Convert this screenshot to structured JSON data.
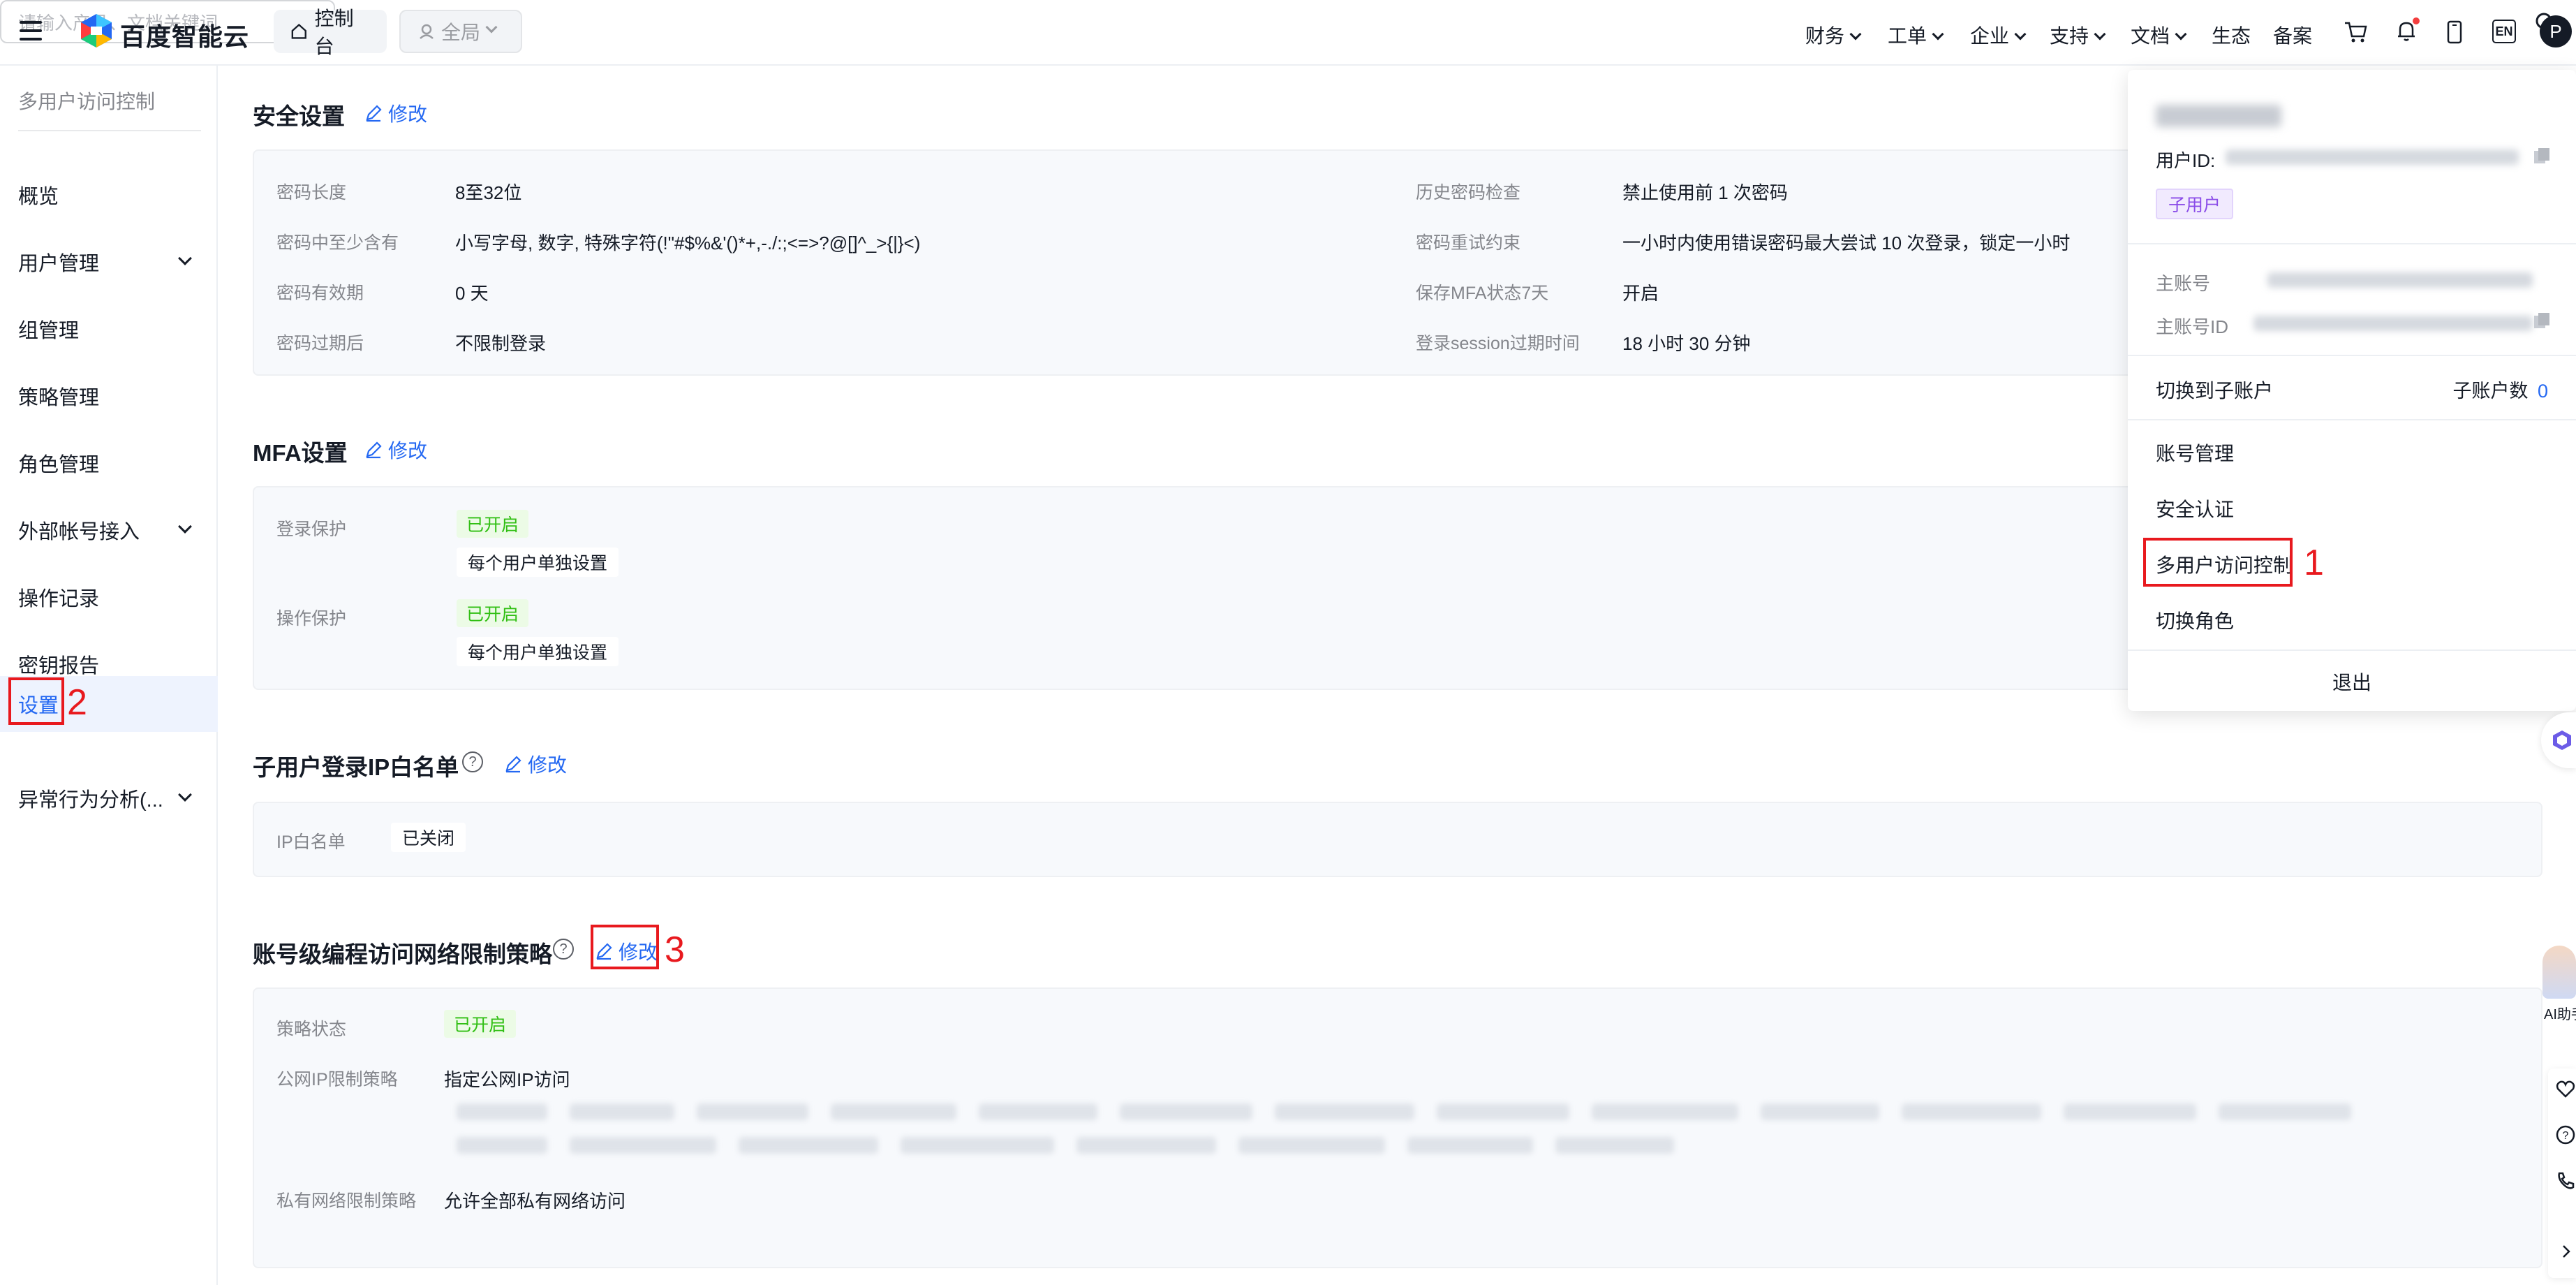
{
  "topbar": {
    "logo_text": "百度智能云",
    "console": "控制台",
    "region": "全局",
    "search_placeholder": "请输入产品、文档关键词",
    "nav": [
      {
        "label": "财务",
        "has_menu": true
      },
      {
        "label": "工单",
        "has_menu": true
      },
      {
        "label": "企业",
        "has_menu": true
      },
      {
        "label": "支持",
        "has_menu": true
      },
      {
        "label": "文档",
        "has_menu": true
      },
      {
        "label": "生态",
        "has_menu": false
      },
      {
        "label": "备案",
        "has_menu": false
      }
    ],
    "lang": "EN",
    "avatar": "P",
    "icons": [
      "cart-icon",
      "bell-icon",
      "phone-icon"
    ]
  },
  "sidebar": {
    "title": "多用户访问控制",
    "items": [
      {
        "label": "概览",
        "has_children": false
      },
      {
        "label": "用户管理",
        "has_children": true
      },
      {
        "label": "组管理",
        "has_children": false
      },
      {
        "label": "策略管理",
        "has_children": false
      },
      {
        "label": "角色管理",
        "has_children": false
      },
      {
        "label": "外部帐号接入",
        "has_children": true
      },
      {
        "label": "操作记录",
        "has_children": false
      },
      {
        "label": "密钥报告",
        "has_children": false
      },
      {
        "label": "设置",
        "has_children": false,
        "active": true
      },
      {
        "label": "异常行为分析(...",
        "has_children": true
      }
    ]
  },
  "sections": {
    "security": {
      "title": "安全设置",
      "edit": "修改",
      "rows": [
        {
          "label": "密码长度",
          "value": "8至32位"
        },
        {
          "label": "密码中至少含有",
          "value": "小写字母, 数字, 特殊字符(!\"#$%&'()*+,-./:;<=>?@[]^_>{|}<)"
        },
        {
          "label": "密码有效期",
          "value": "0 天"
        },
        {
          "label": "密码过期后",
          "value": "不限制登录"
        }
      ],
      "rows_right": [
        {
          "label": "历史密码检查",
          "value": "禁止使用前 1 次密码"
        },
        {
          "label": "密码重试约束",
          "value": "一小时内使用错误密码最大尝试 10 次登录，锁定一小时"
        },
        {
          "label": "保存MFA状态7天",
          "value": "开启"
        },
        {
          "label": "登录session过期时间",
          "value": "18 小时 30 分钟"
        }
      ]
    },
    "mfa": {
      "title": "MFA设置",
      "edit": "修改",
      "rows": [
        {
          "label": "登录保护",
          "status": "已开启",
          "detail": "每个用户单独设置"
        },
        {
          "label": "操作保护",
          "status": "已开启",
          "detail": "每个用户单独设置"
        }
      ]
    },
    "ip_whitelist": {
      "title": "子用户登录IP白名单",
      "edit": "修改",
      "label": "IP白名单",
      "status": "已关闭"
    },
    "network_policy": {
      "title": "账号级编程访问网络限制策略",
      "edit": "修改",
      "status_label": "策略状态",
      "status": "已开启",
      "public_label": "公网IP限制策略",
      "public_value": "指定公网IP访问",
      "private_label": "私有网络限制策略",
      "private_value": "允许全部私有网络访问"
    }
  },
  "dropdown": {
    "user_id_label": "用户ID:",
    "role_tag": "子用户",
    "main_account_label": "主账号",
    "main_account_id_label": "主账号ID",
    "switch_sub": "切换到子账户",
    "sub_count_label": "子账户数",
    "sub_count": "0",
    "items": [
      "账号管理",
      "安全认证",
      "多用户访问控制",
      "切换角色"
    ],
    "logout": "退出"
  },
  "annotations": [
    "1",
    "2",
    "3"
  ],
  "side_float": {
    "ai_label": "AI助手"
  },
  "colors": {
    "accent": "#2468f2",
    "annotation": "#e8191e",
    "success": "#30bf13"
  }
}
